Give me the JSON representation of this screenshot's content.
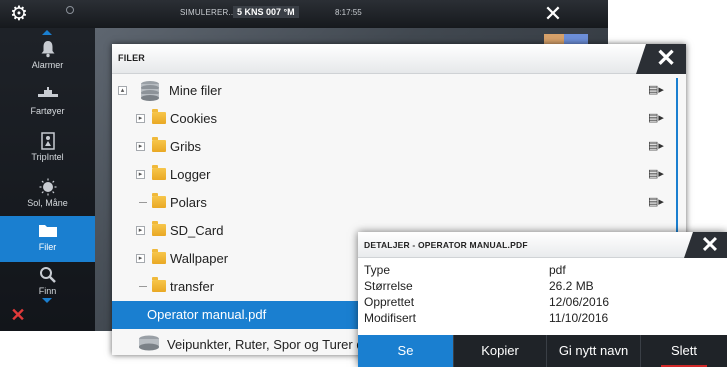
{
  "topbar": {
    "status_text": "SIMULERER...",
    "speed_text": "5 KNS 007 °M",
    "time": "8:17:55"
  },
  "sidebar": {
    "items": [
      {
        "label": "Alarmer",
        "icon": "bell-icon"
      },
      {
        "label": "Fartøyer",
        "icon": "vessel-icon"
      },
      {
        "label": "TripIntel",
        "icon": "tripintel-icon"
      },
      {
        "label": "Sol, Måne",
        "icon": "sun-moon-icon"
      },
      {
        "label": "Filer",
        "icon": "folder-icon",
        "active": true
      },
      {
        "label": "Finn",
        "icon": "search-icon"
      }
    ]
  },
  "files_dialog": {
    "title": "FILER",
    "items": [
      {
        "label": "Mine filer"
      },
      {
        "label": "Cookies"
      },
      {
        "label": "Gribs"
      },
      {
        "label": "Logger"
      },
      {
        "label": "Polars"
      },
      {
        "label": "SD_Card"
      },
      {
        "label": "Wallpaper"
      },
      {
        "label": "transfer"
      },
      {
        "label": "Operator manual.pdf"
      },
      {
        "label": "Veipunkter, Ruter, Spor og Turer databa"
      }
    ]
  },
  "details_dialog": {
    "title": "DETALJER - OPERATOR MANUAL.PDF",
    "fields": [
      {
        "key": "Type",
        "value": "pdf"
      },
      {
        "key": "Størrelse",
        "value": "26.2 MB"
      },
      {
        "key": "Opprettet",
        "value": "12/06/2016"
      },
      {
        "key": "Modifisert",
        "value": "11/10/2016"
      }
    ],
    "actions": [
      "Se",
      "Kopier",
      "Gi nytt navn",
      "Slett"
    ]
  },
  "colors": {
    "accent": "#1a7fd0",
    "folder": "#f0b93a",
    "danger": "#e03a3a"
  }
}
